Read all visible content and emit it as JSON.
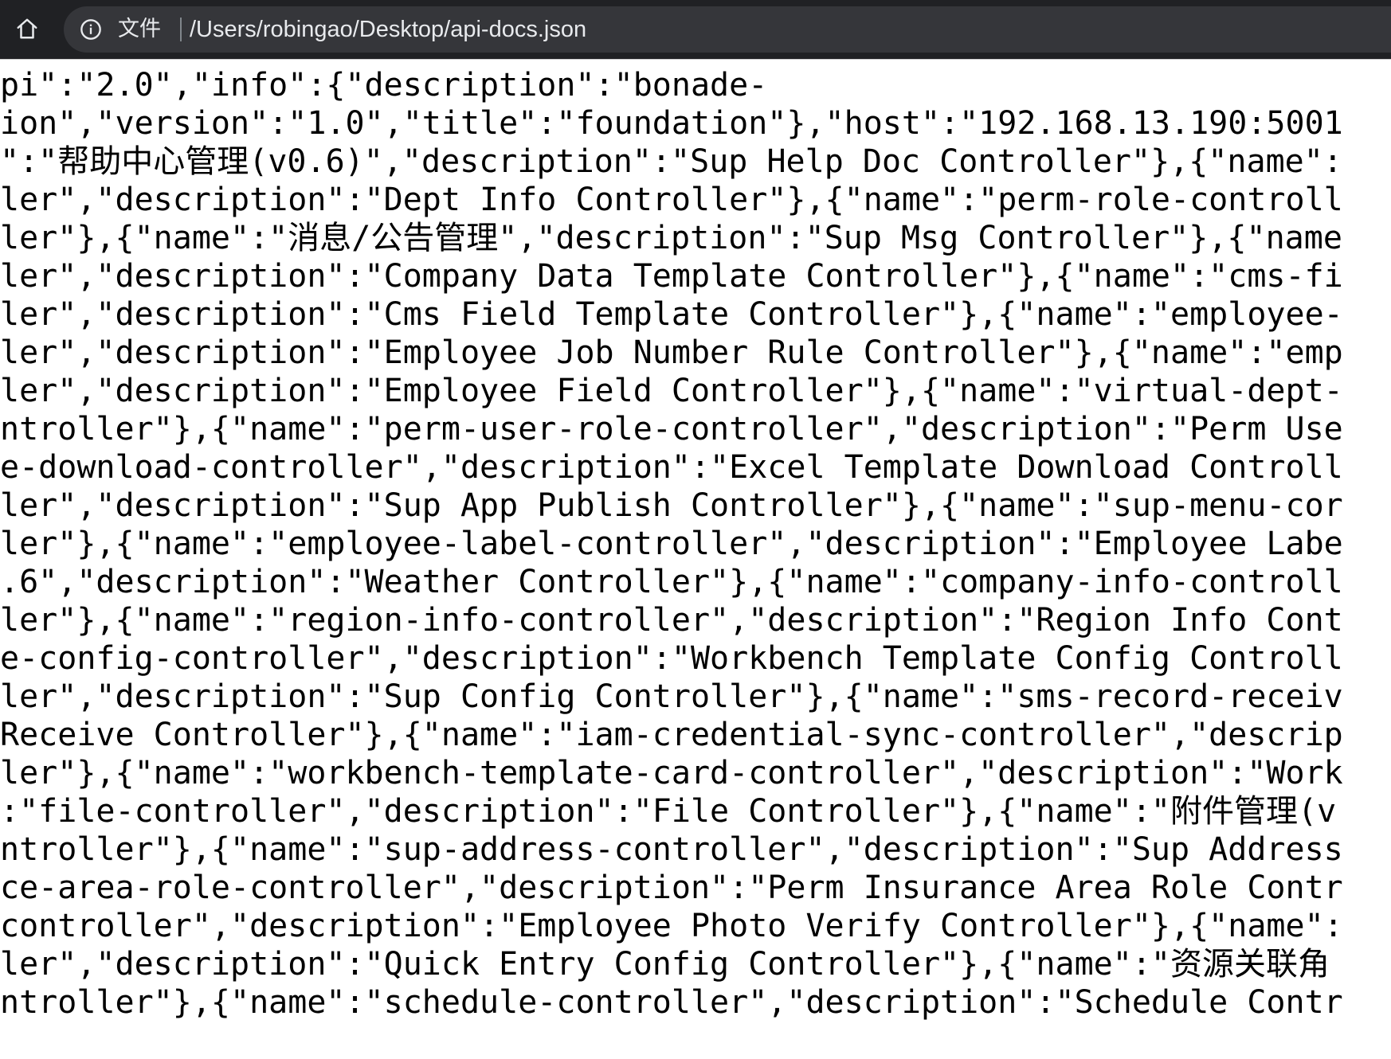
{
  "browser": {
    "home_icon": "home-icon",
    "info_icon": "info-icon",
    "scheme_label": "文件",
    "url": "/Users/robingao/Desktop/api-docs.json",
    "toolbar_color": "#202124",
    "omnibox_color": "#35363a",
    "text_color": "#e8eaed"
  },
  "content": {
    "lines": [
      "pi\":\"2.0\",\"info\":{\"description\":\"bonade-",
      "ion\",\"version\":\"1.0\",\"title\":\"foundation\"},\"host\":\"192.168.13.190:5001",
      "\":\"帮助中心管理(v0.6)\",\"description\":\"Sup Help Doc Controller\"},{\"name\":",
      "ler\",\"description\":\"Dept Info Controller\"},{\"name\":\"perm-role-controll",
      "ler\"},{\"name\":\"消息/公告管理\",\"description\":\"Sup Msg Controller\"},{\"name",
      "ler\",\"description\":\"Company Data Template Controller\"},{\"name\":\"cms-fi",
      "ler\",\"description\":\"Cms Field Template Controller\"},{\"name\":\"employee-",
      "ler\",\"description\":\"Employee Job Number Rule Controller\"},{\"name\":\"emp",
      "ler\",\"description\":\"Employee Field Controller\"},{\"name\":\"virtual-dept-",
      "ntroller\"},{\"name\":\"perm-user-role-controller\",\"description\":\"Perm Use",
      "e-download-controller\",\"description\":\"Excel Template Download Controll",
      "ler\",\"description\":\"Sup App Publish Controller\"},{\"name\":\"sup-menu-cor",
      "ler\"},{\"name\":\"employee-label-controller\",\"description\":\"Employee Labe",
      ".6\",\"description\":\"Weather Controller\"},{\"name\":\"company-info-controll",
      "ler\"},{\"name\":\"region-info-controller\",\"description\":\"Region Info Cont",
      "e-config-controller\",\"description\":\"Workbench Template Config Controll",
      "ler\",\"description\":\"Sup Config Controller\"},{\"name\":\"sms-record-receiv",
      "Receive Controller\"},{\"name\":\"iam-credential-sync-controller\",\"descrip",
      "ler\"},{\"name\":\"workbench-template-card-controller\",\"description\":\"Work",
      ":\"file-controller\",\"description\":\"File Controller\"},{\"name\":\"附件管理(v",
      "ntroller\"},{\"name\":\"sup-address-controller\",\"description\":\"Sup Address",
      "ce-area-role-controller\",\"description\":\"Perm Insurance Area Role Contr",
      "controller\",\"description\":\"Employee Photo Verify Controller\"},{\"name\":",
      "ler\",\"description\":\"Quick Entry Config Controller\"},{\"name\":\"资源关联角",
      "ntroller\"},{\"name\":\"schedule-controller\",\"description\":\"Schedule Contr"
    ],
    "text_color": "#000000",
    "background": "#ffffff"
  }
}
